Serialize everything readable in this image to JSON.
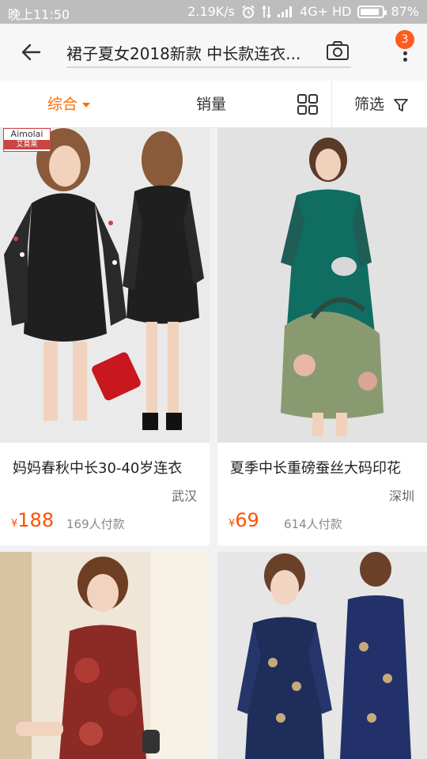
{
  "status_bar": {
    "time": "晚上11:50",
    "speed": "2.19K/s",
    "network": "4G+ HD",
    "battery": "87%",
    "battery_level": 0.87
  },
  "app_bar": {
    "search_query": "裙子夏女2018新款 中长款连衣...",
    "badge_count": "3"
  },
  "filter_bar": {
    "tabs": [
      {
        "label": "综合",
        "active": true
      },
      {
        "label": "销量",
        "active": false
      },
      {
        "label": "筛选",
        "active": false
      }
    ]
  },
  "products": [
    {
      "title": "妈妈春秋中长30-40岁连衣",
      "city": "武汉",
      "currency": "¥",
      "price": "188",
      "sold": "169人付款",
      "brand_logo": "Aimolai",
      "brand_logo_sub": "艾莫莱"
    },
    {
      "title": "夏季中长重磅蚕丝大码印花",
      "city": "深圳",
      "currency": "¥",
      "price": "69",
      "sold": "614人付款"
    },
    {
      "title": "",
      "city": "",
      "currency": "",
      "price": "",
      "sold": ""
    },
    {
      "title": "",
      "city": "",
      "currency": "",
      "price": "",
      "sold": ""
    }
  ],
  "colors": {
    "accent": "#ff6a00",
    "price": "#ff5000",
    "badge": "#ff5a1f"
  }
}
